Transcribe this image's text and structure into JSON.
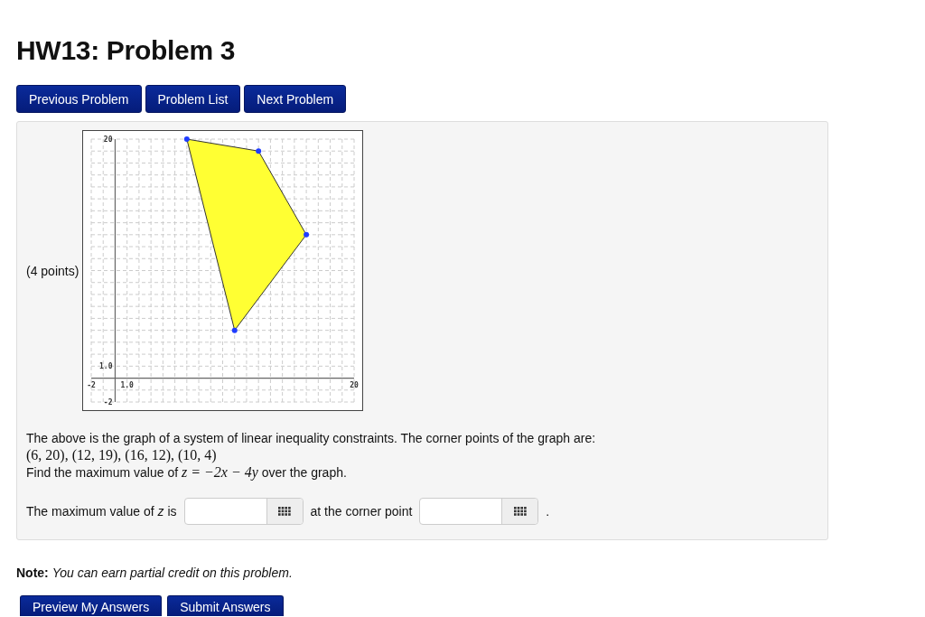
{
  "page": {
    "title": "HW13: Problem 3"
  },
  "nav_buttons": [
    "Previous Problem",
    "Problem List",
    "Next Problem"
  ],
  "problem": {
    "points": "(4 points)",
    "graph": {
      "chart_data": {
        "type": "scatter",
        "x": [
          6,
          12,
          16,
          10
        ],
        "series": [
          {
            "color": "#1f3dff",
            "values": [
              20,
              19,
              12,
              4
            ]
          }
        ],
        "xlim": [
          -2,
          20
        ],
        "ylim": [
          -2,
          20
        ],
        "xticks": [
          {
            "value": -2,
            "label": "-2"
          },
          {
            "value": 1,
            "label": "1.0"
          },
          {
            "value": 20,
            "label": "20"
          }
        ],
        "yticks": [
          {
            "value": -2,
            "label": "-2"
          },
          {
            "value": 1,
            "label": "1.0"
          },
          {
            "value": 20,
            "label": "20"
          }
        ]
      }
    },
    "intro": "The above is the graph of a system of linear inequality constraints. The corner points of the graph are:",
    "corner_points": "(6, 20), (12, 19), (16, 12), (10, 4)",
    "question": {
      "before": "Find the maximum value of",
      "math": "z = −2x − 4y",
      "after": "over the graph."
    },
    "answer_row": [
      {
        "kind": "text",
        "text": "The maximum value of *z* is"
      },
      {
        "kind": "input"
      },
      {
        "kind": "text",
        "text": "at the corner point"
      },
      {
        "kind": "input"
      },
      {
        "kind": "text",
        "text": "."
      }
    ]
  },
  "note": "**Note:** *You can earn partial credit on this problem.*",
  "submit_buttons": [
    "Preview My Answers",
    "Submit Answers"
  ]
}
